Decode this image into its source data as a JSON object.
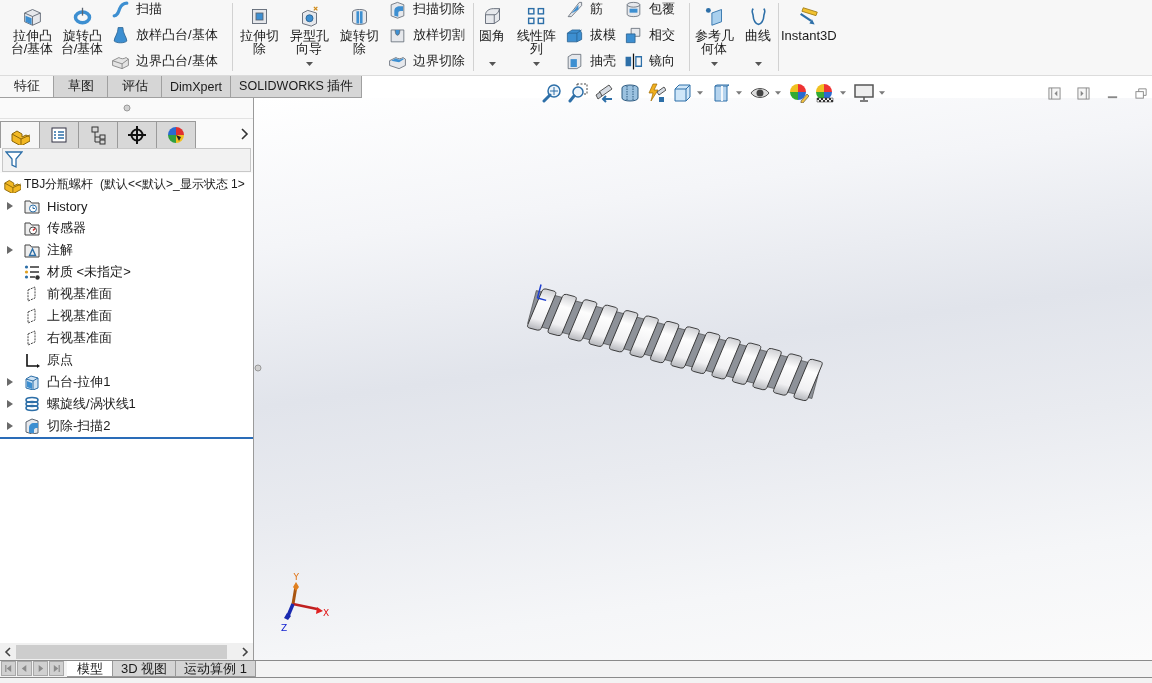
{
  "ribbon": {
    "groups": [
      {
        "items": [
          {
            "kind": "large",
            "label": "拉伸凸台/基体",
            "dropdown": false
          },
          {
            "kind": "large",
            "label": "旋转凸台/基体",
            "dropdown": false
          },
          {
            "kind": "stack",
            "items": [
              {
                "label": "扫描"
              },
              {
                "label": "放样凸台/基体"
              },
              {
                "label": "边界凸台/基体"
              }
            ]
          }
        ]
      },
      {
        "items": [
          {
            "kind": "large",
            "label": "拉伸切除",
            "dropdown": false
          },
          {
            "kind": "large",
            "label": "异型孔向导",
            "dropdown": true
          },
          {
            "kind": "large",
            "label": "旋转切除",
            "dropdown": false
          },
          {
            "kind": "stack",
            "items": [
              {
                "label": "扫描切除"
              },
              {
                "label": "放样切割"
              },
              {
                "label": "边界切除"
              }
            ]
          }
        ]
      },
      {
        "items": [
          {
            "kind": "large",
            "label": "圆角",
            "dropdown": true
          },
          {
            "kind": "large",
            "label": "线性阵列",
            "dropdown": true
          },
          {
            "kind": "stack",
            "items": [
              {
                "label": "筋"
              },
              {
                "label": "拔模"
              },
              {
                "label": "抽壳"
              }
            ]
          },
          {
            "kind": "stack",
            "items": [
              {
                "label": "包覆"
              },
              {
                "label": "相交"
              },
              {
                "label": "镜向"
              }
            ]
          }
        ]
      },
      {
        "items": [
          {
            "kind": "large",
            "label": "参考几何体",
            "dropdown": true
          },
          {
            "kind": "large",
            "label": "曲线",
            "dropdown": true
          }
        ]
      },
      {
        "items": [
          {
            "kind": "large",
            "label": "Instant3D",
            "dropdown": false
          }
        ]
      }
    ]
  },
  "command_tabs": [
    {
      "label": "特征",
      "selected": true
    },
    {
      "label": "草图",
      "selected": false
    },
    {
      "label": "评估",
      "selected": false
    },
    {
      "label": "DimXpert",
      "selected": false
    },
    {
      "label": "SOLIDWORKS 插件",
      "selected": false
    }
  ],
  "panel_tabs": [
    {
      "selected": true
    },
    {
      "selected": false
    },
    {
      "selected": false
    },
    {
      "selected": false
    },
    {
      "selected": false
    }
  ],
  "feature_tree": {
    "root": "TBJ分瓶螺杆  (默认<<默认>_显示状态 1>",
    "items": [
      {
        "label": "History",
        "expandable": true
      },
      {
        "label": "传感器",
        "expandable": false
      },
      {
        "label": "注解",
        "expandable": true
      },
      {
        "label": "材质 <未指定>",
        "expandable": false
      },
      {
        "label": "前视基准面",
        "expandable": false
      },
      {
        "label": "上视基准面",
        "expandable": false
      },
      {
        "label": "右视基准面",
        "expandable": false
      },
      {
        "label": "原点",
        "expandable": false
      },
      {
        "label": "凸台-拉伸1",
        "expandable": true
      },
      {
        "label": "螺旋线/涡状线1",
        "expandable": true
      },
      {
        "label": "切除-扫描2",
        "expandable": true
      }
    ]
  },
  "triad": {
    "x_label": "X",
    "y_label": "Y",
    "z_label": "Z"
  },
  "bottom_tabs": [
    {
      "label": "模型",
      "selected": true
    },
    {
      "label": "3D 视图",
      "selected": false
    },
    {
      "label": "运动算例 1",
      "selected": false
    }
  ]
}
